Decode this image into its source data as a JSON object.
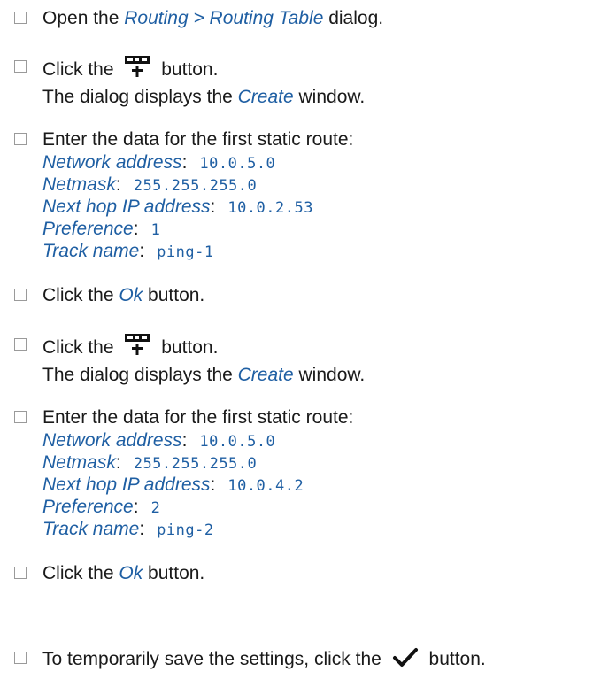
{
  "steps": [
    {
      "pre": "Open the ",
      "ref": "Routing > Routing Table",
      "post": " dialog."
    },
    {
      "pre": "Click the",
      "icon": "add-table-row-icon",
      "post": "button.",
      "sub_pre": "The dialog displays the ",
      "sub_ref": "Create",
      "sub_post": " window."
    },
    {
      "text": "Enter the data for the first static route:",
      "fields": [
        {
          "label": "Network address",
          "value": "10.0.5.0"
        },
        {
          "label": "Netmask",
          "value": "255.255.255.0"
        },
        {
          "label": "Next hop IP address",
          "value": "10.0.2.53"
        },
        {
          "label": "Preference",
          "value": "1"
        },
        {
          "label": "Track name",
          "value": "ping-1"
        }
      ]
    },
    {
      "pre": "Click the ",
      "ref": "Ok",
      "post": " button."
    },
    {
      "pre": "Click the",
      "icon": "add-table-row-icon",
      "post": "button.",
      "sub_pre": "The dialog displays the ",
      "sub_ref": "Create",
      "sub_post": " window."
    },
    {
      "text": "Enter the data for the first static route:",
      "fields": [
        {
          "label": "Network address",
          "value": "10.0.5.0"
        },
        {
          "label": "Netmask",
          "value": "255.255.255.0"
        },
        {
          "label": "Next hop IP address",
          "value": "10.0.4.2"
        },
        {
          "label": "Preference",
          "value": "2"
        },
        {
          "label": "Track name",
          "value": "ping-2"
        }
      ]
    },
    {
      "pre": "Click the ",
      "ref": "Ok",
      "post": " button."
    },
    {
      "pre": "To temporarily save the settings, click the",
      "icon": "checkmark-icon",
      "post": "button."
    }
  ],
  "colon": ":"
}
